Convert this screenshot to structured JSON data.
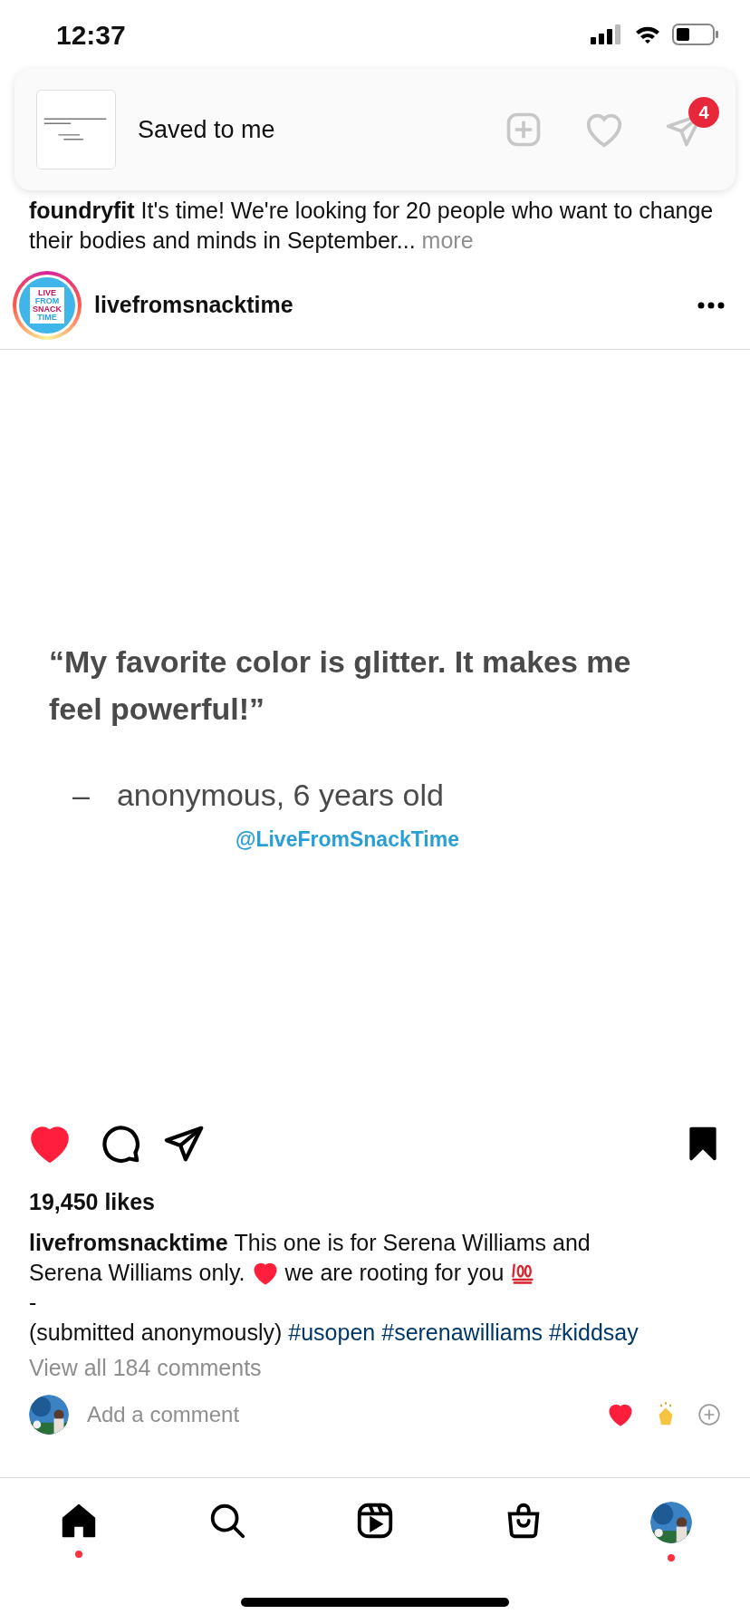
{
  "status_bar": {
    "time": "12:37"
  },
  "toast": {
    "message": "Saved to me"
  },
  "header": {
    "messages_badge": "4"
  },
  "previous_post": {
    "username": "foundryfit",
    "text": "It's time! We're looking for 20 people who want to change their bodies and minds in September...",
    "more": "more"
  },
  "post": {
    "username": "livefromsnacktime",
    "avatar_text": [
      "LIVE",
      "FROM",
      "SNACK",
      "TIME"
    ],
    "image": {
      "quote": "“My favorite color is glitter. It makes me feel powerful!”",
      "dash": "–",
      "attribution": "anonymous, 6 years old",
      "handle": "@LiveFromSnackTime"
    },
    "liked": true,
    "saved": true,
    "likes": "19,450 likes",
    "caption_username": "livefromsnacktime",
    "caption": [
      [
        {
          "kind": "text",
          "text": "This one is for Serena Williams and"
        }
      ],
      [
        {
          "kind": "text",
          "text": "Serena Williams only."
        },
        {
          "kind": "heart"
        },
        {
          "kind": "text",
          "text": "we are rooting for you"
        },
        {
          "kind": "hundred"
        }
      ]
    ],
    "caption_lines": [
      {
        "kind": "text",
        "text": "-"
      },
      {
        "kind": "text",
        "text": "(submitted anonymously)"
      },
      {
        "kind": "tag",
        "text": "#usopen"
      },
      {
        "kind": "tag",
        "text": "#serenawilliams"
      },
      {
        "kind": "tag",
        "text": "#kiddsay"
      }
    ],
    "view_comments": "View all 184 comments",
    "comment_placeholder": "Add a comment"
  },
  "nav": [
    {
      "kind": "home",
      "selected": true,
      "dot": true
    },
    {
      "kind": "search",
      "selected": false,
      "dot": false
    },
    {
      "kind": "reels",
      "selected": false,
      "dot": false
    },
    {
      "kind": "shop",
      "selected": false,
      "dot": false
    },
    {
      "kind": "profile",
      "selected": false,
      "dot": true
    }
  ]
}
